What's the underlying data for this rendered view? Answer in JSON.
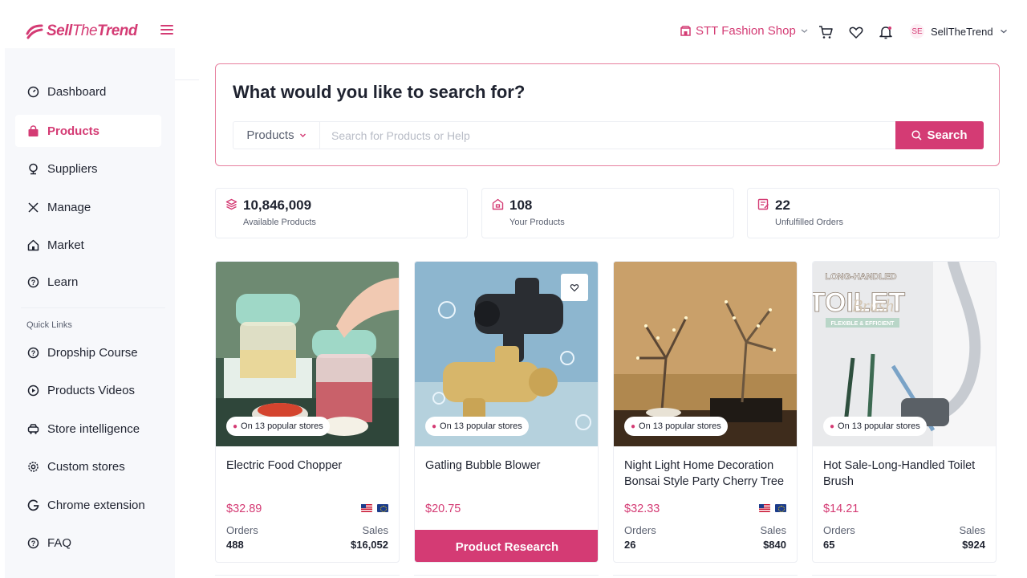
{
  "brand": {
    "name_part1": "Sell",
    "name_part2": "The",
    "name_part3": "Trend",
    "accent": "#d43b74"
  },
  "header": {
    "shop_name": "STT Fashion Shop",
    "user_initials": "SE",
    "user_name": "SellTheTrend",
    "icons": [
      "cart-icon",
      "heart-icon",
      "bell-icon"
    ]
  },
  "sidebar": {
    "items": [
      {
        "label": "Dashboard",
        "icon": "gauge-icon"
      },
      {
        "label": "Products",
        "icon": "bag-icon",
        "active": true
      },
      {
        "label": "Suppliers",
        "icon": "supplier-icon"
      },
      {
        "label": "Manage",
        "icon": "tools-icon"
      },
      {
        "label": "Market",
        "icon": "home-icon"
      },
      {
        "label": "Learn",
        "icon": "help-icon"
      }
    ],
    "quick_links_title": "Quick Links",
    "quick_links": [
      {
        "label": "Dropship Course",
        "icon": "help-icon"
      },
      {
        "label": "Products Videos",
        "icon": "play-icon"
      },
      {
        "label": "Store intelligence",
        "icon": "car-icon"
      },
      {
        "label": "Custom stores",
        "icon": "gear-icon"
      },
      {
        "label": "Chrome extension",
        "icon": "google-icon"
      },
      {
        "label": "FAQ",
        "icon": "help-icon"
      }
    ]
  },
  "search": {
    "title": "What would you like to search for?",
    "category": "Products",
    "placeholder": "Search for Products or Help",
    "button_label": "Search"
  },
  "stats": [
    {
      "value": "10,846,009",
      "label": "Available Products",
      "icon": "layers-icon"
    },
    {
      "value": "108",
      "label": "Your Products",
      "icon": "store-icon"
    },
    {
      "value": "22",
      "label": "Unfulfilled Orders",
      "icon": "orders-icon"
    }
  ],
  "products": [
    {
      "title": "Electric Food Chopper",
      "badge": "On 13 popular stores",
      "price": "$32.89",
      "orders_label": "Orders",
      "orders": "488",
      "sales_label": "Sales",
      "sales": "$16,052",
      "flags": [
        "us",
        "eu"
      ]
    },
    {
      "title": "Gatling Bubble Blower",
      "badge": "On 13 popular stores",
      "price": "$20.75",
      "button_label": "Product Research"
    },
    {
      "title": "Night Light Home Decoration Bonsai Style Party Cherry Tree",
      "badge": "On 13 popular stores",
      "price": "$32.33",
      "orders_label": "Orders",
      "orders": "26",
      "sales_label": "Sales",
      "sales": "$840",
      "flags": [
        "us",
        "eu"
      ]
    },
    {
      "title": "Hot Sale-Long-Handled Toilet Brush",
      "badge": "On 13 popular stores",
      "price": "$14.21",
      "orders_label": "Orders",
      "orders": "65",
      "sales_label": "Sales",
      "sales": "$924",
      "image_text_1": "LONG-HANDLED",
      "image_text_2": "TOILET",
      "image_text_3": "Brush",
      "image_text_4": "FLEXIBLE & EFFICIENT"
    }
  ]
}
